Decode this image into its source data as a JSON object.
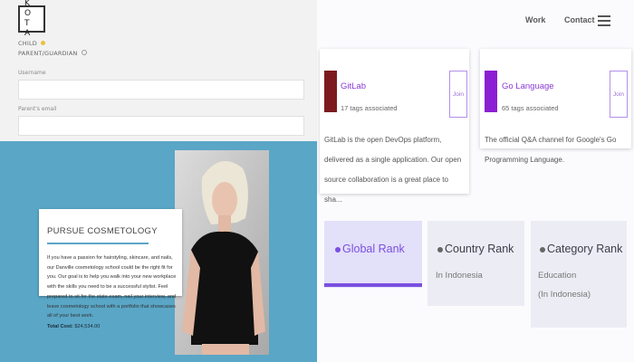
{
  "logo": {
    "line1": "K O",
    "line2": "T A"
  },
  "nav": {
    "work": "Work",
    "contact": "Contact"
  },
  "form": {
    "child_option": "CHILD",
    "parent_option": "PARENT/GUARDIAN",
    "username_label": "Username",
    "parent_email_label": "Parent's email"
  },
  "promo": {
    "title": "PURSUE COSMETOLOGY",
    "body": "If you have a passion for hairstyling, skincare, and nails, our Danville cosmetology school could be the right fit for you. Our goal is to help you walk into your new workplace with the skills you need to be a successful stylist. Feel prepared to sit for the state exam, nail your interview, and leave cosmetology school with a portfolio that showcases all of your best work.",
    "cost_label": "Total Cost:",
    "cost_value": "$24,534.00"
  },
  "tags": [
    {
      "name": "GitLab",
      "count": "17 tags associated",
      "join": "Join",
      "desc": "GitLab is the open DevOps platform, delivered as a single application. Our open source collaboration is a great place to sha...",
      "logo_color": "#7c1b1f",
      "logo_icon": "fox-icon"
    },
    {
      "name": "Go Language",
      "count": "65 tags associated",
      "join": "Join",
      "desc": "The official Q&A channel for Google's Go Programming Language.",
      "logo_color": "#8b1fd3",
      "logo_icon": "go-gopher-icon"
    }
  ],
  "ranks": [
    {
      "title": "Global Rank",
      "sub1": "",
      "sub2": ""
    },
    {
      "title": "Country Rank",
      "sub1": "In Indonesia",
      "sub2": ""
    },
    {
      "title": "Category Rank",
      "sub1": "Education",
      "sub2": "(In Indonesia)"
    }
  ],
  "colors": {
    "promo_bg": "#5aa6c6",
    "accent_purple": "#7b4fe0"
  }
}
